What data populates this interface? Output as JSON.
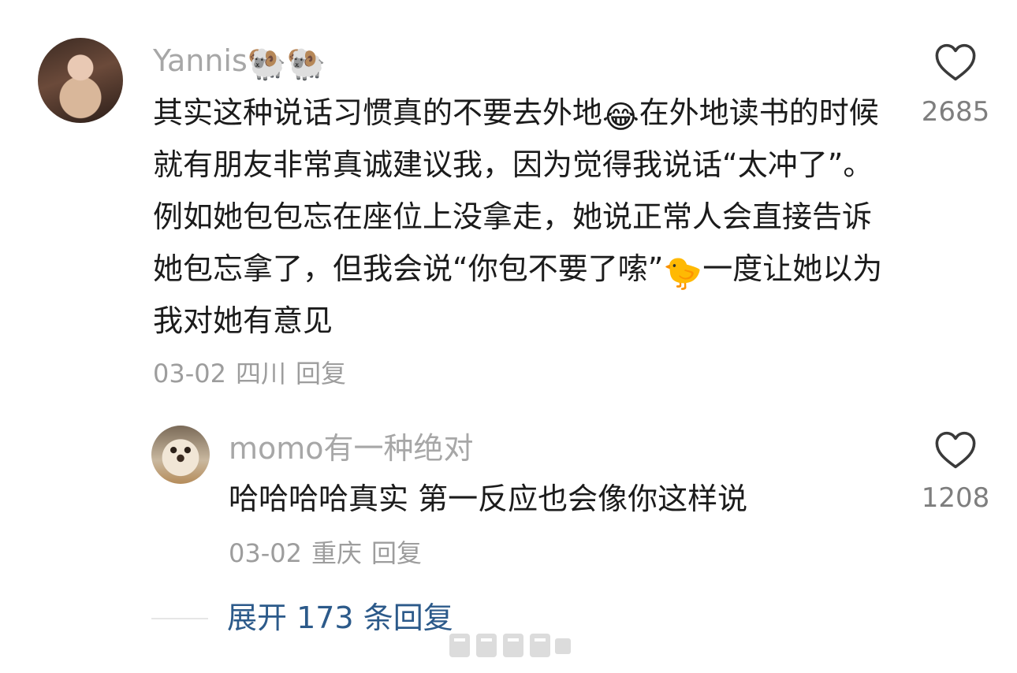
{
  "comment": {
    "username": "Yannis",
    "username_emojis": "🐏🐏",
    "text_part1": "其实这种说话习惯真的不要去外地",
    "emoji1": "😂",
    "text_part2": "在外地读书的时候就有朋友非常真诚建议我，因为觉得我说话“太冲了”。例如她包包忘在座位上没拿走，她说正常人会直接告诉她包忘拿了，但我会说“你包不要了嗦”",
    "emoji2": "🐤",
    "text_part3": "一度让她以为我对她有意见",
    "date": "03-02",
    "location": "四川",
    "reply_label": "回复",
    "like_count": "2685"
  },
  "reply": {
    "username": "momo有一种绝对",
    "text": "哈哈哈哈真实 第一反应也会像你这样说",
    "date": "03-02",
    "location": "重庆",
    "reply_label": "回复",
    "like_count": "1208"
  },
  "expand": {
    "label": "展开 173 条回复"
  },
  "icons": {
    "like": "heart-outline-icon",
    "watermark": "weibo-watermark"
  },
  "colors": {
    "username": "#a7a7a7",
    "content": "#1b1b1b",
    "meta": "#9d9d9d",
    "link": "#2c5a8a"
  }
}
